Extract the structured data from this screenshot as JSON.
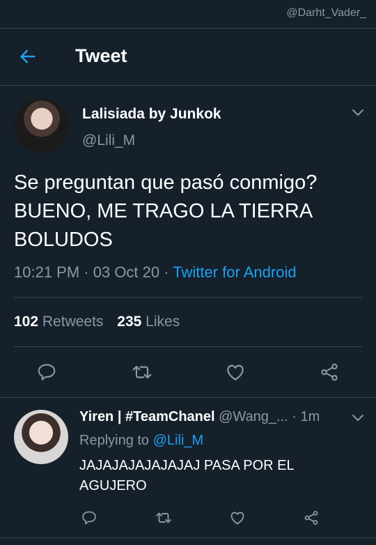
{
  "watermark": "@Darht_Vader_",
  "header": {
    "title": "Tweet"
  },
  "tweet": {
    "author_name": "Lalisiada by Junkok",
    "author_handle": "@Lili_M",
    "text_line1": "Se preguntan que pasó conmigo?",
    "text_line2": "BUENO, ME TRAGO LA TIERRA",
    "text_line3": "BOLUDOS",
    "time": "10:21 PM",
    "dot1": " · ",
    "date": "03 Oct 20",
    "dot2": " · ",
    "source": "Twitter for Android",
    "retweets_count": "102",
    "retweets_label": "Retweets",
    "likes_count": "235",
    "likes_label": "Likes"
  },
  "reply": {
    "author_name": "Yiren | #TeamChanel",
    "author_handle": "@Wang_...",
    "time": "· 1m",
    "replying_to_label": "Replying to",
    "replying_to_handle": "@Lili_M",
    "text_line1": "JAJAJAJAJAJAJAJ PASA POR EL",
    "text_line2": "AGUJERO"
  },
  "colors": {
    "background": "#15202b",
    "accent": "#1da1f2",
    "muted": "#8899a6",
    "divider": "#38444d"
  },
  "icons": [
    "back-arrow-icon",
    "chevron-down-icon",
    "reply-icon",
    "retweet-icon",
    "like-icon",
    "share-icon"
  ]
}
